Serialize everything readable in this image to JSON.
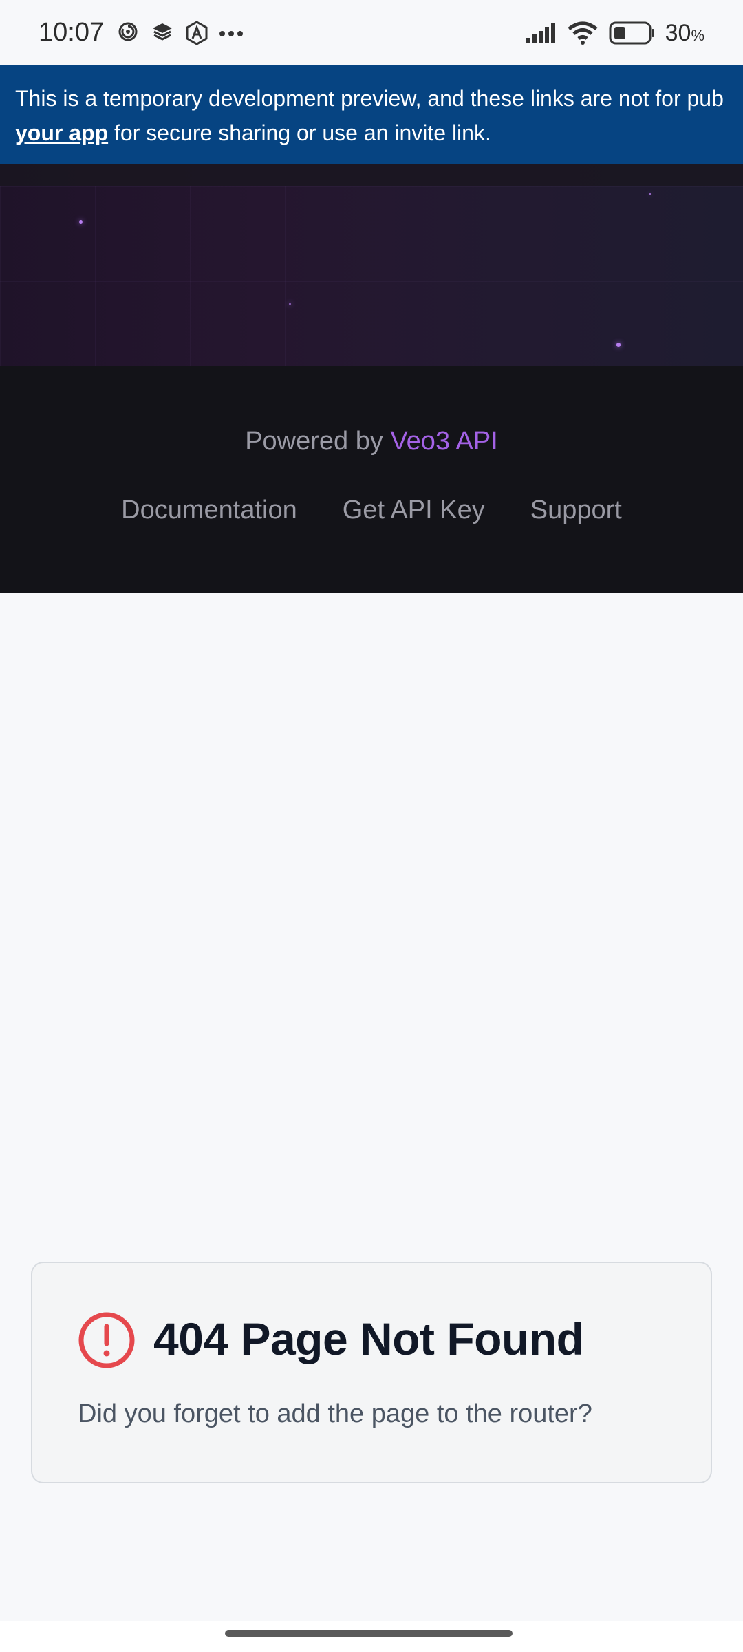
{
  "status_bar": {
    "time": "10:07",
    "icons": [
      "swirl-icon",
      "layers-icon",
      "translate-icon",
      "more-icon"
    ],
    "right_icons": [
      "signal-icon",
      "wifi-icon",
      "battery-icon"
    ],
    "battery_percent": "30",
    "battery_unit": "%"
  },
  "dev_banner": {
    "line1": "This is a temporary development preview, and these links are not for pub",
    "link": "your app",
    "line2_rest": " for secure sharing or use an invite link.",
    "bg_color": "#064482"
  },
  "footer": {
    "powered_prefix": "Powered by ",
    "powered_brand": "Veo3 API",
    "brand_color": "#a462e6",
    "links": [
      "Documentation",
      "Get API Key",
      "Support"
    ]
  },
  "error_card": {
    "icon": "alert-circle-icon",
    "icon_color": "#e5484d",
    "title": "404 Page Not Found",
    "message": "Did you forget to add the page to the router?"
  }
}
